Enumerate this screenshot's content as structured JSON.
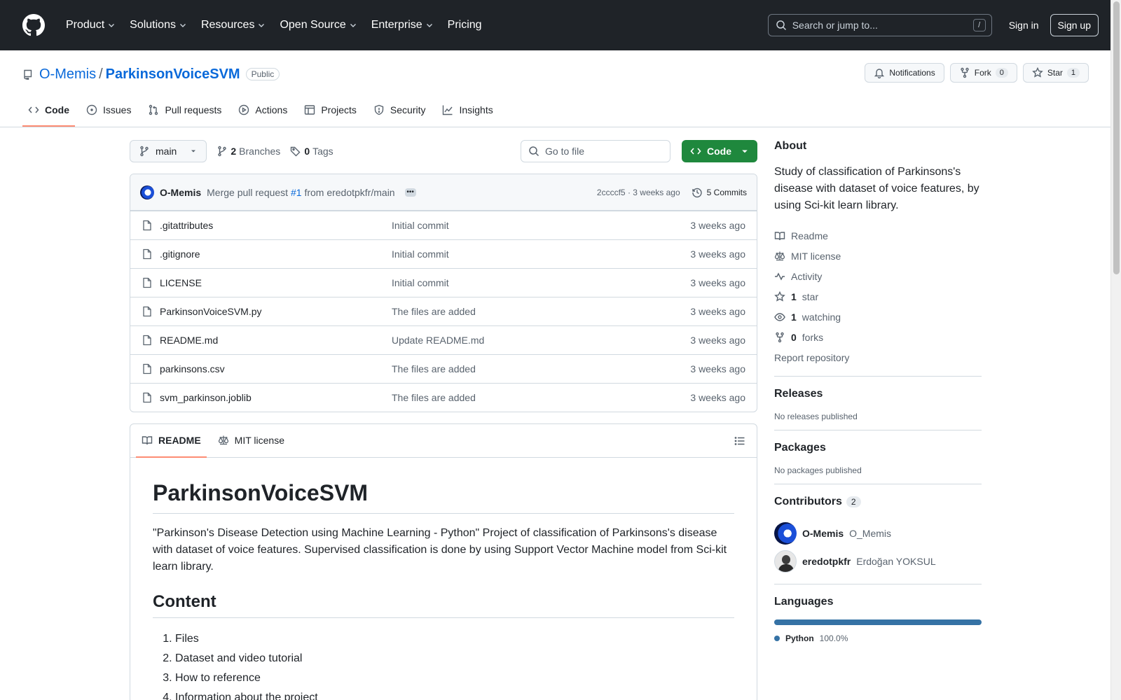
{
  "nav": {
    "items": [
      "Product",
      "Solutions",
      "Resources",
      "Open Source",
      "Enterprise",
      "Pricing"
    ],
    "search_placeholder": "Search or jump to...",
    "search_kbd": "/",
    "signin": "Sign in",
    "signup": "Sign up"
  },
  "repo": {
    "owner": "O-Memis",
    "slash": "/",
    "name": "ParkinsonVoiceSVM",
    "visibility": "Public",
    "notifications": "Notifications",
    "fork": "Fork",
    "fork_count": "0",
    "star": "Star",
    "star_count": "1",
    "tabs": [
      "Code",
      "Issues",
      "Pull requests",
      "Actions",
      "Projects",
      "Security",
      "Insights"
    ]
  },
  "toolbar": {
    "branch": "main",
    "branches_count": "2",
    "branches_label": "Branches",
    "tags_count": "0",
    "tags_label": "Tags",
    "goto_placeholder": "Go to file",
    "code_button": "Code"
  },
  "commit": {
    "author": "O-Memis",
    "msg_prefix": "Merge pull request",
    "pr": "#1",
    "msg_suffix": "from eredotpkfr/main",
    "ellipsis": "•••",
    "hash_time": "2ccccf5 · 3 weeks ago",
    "commits": "5 Commits"
  },
  "files": [
    {
      "name": ".gitattributes",
      "msg": "Initial commit",
      "date": "3 weeks ago"
    },
    {
      "name": ".gitignore",
      "msg": "Initial commit",
      "date": "3 weeks ago"
    },
    {
      "name": "LICENSE",
      "msg": "Initial commit",
      "date": "3 weeks ago"
    },
    {
      "name": "ParkinsonVoiceSVM.py",
      "msg": "The files are added",
      "date": "3 weeks ago"
    },
    {
      "name": "README.md",
      "msg": "Update README.md",
      "date": "3 weeks ago"
    },
    {
      "name": "parkinsons.csv",
      "msg": "The files are added",
      "date": "3 weeks ago"
    },
    {
      "name": "svm_parkinson.joblib",
      "msg": "The files are added",
      "date": "3 weeks ago"
    }
  ],
  "readme": {
    "tab_readme": "README",
    "tab_license": "MIT license",
    "title": "ParkinsonVoiceSVM",
    "intro": "\"Parkinson's Disease Detection using Machine Learning - Python\" Project of classification of Parkinsons's disease with dataset of voice features. Supervised classification is done by using Support Vector Machine model from Sci-kit learn library.",
    "content_heading": "Content",
    "content_items": [
      "Files",
      "Dataset and video tutorial",
      "How to reference",
      "Information about the project"
    ]
  },
  "about": {
    "heading": "About",
    "description": "Study of classification of Parkinsons's disease with dataset of voice features, by using Sci-kit learn library.",
    "readme": "Readme",
    "license": "MIT license",
    "activity": "Activity",
    "stars_count": "1",
    "stars_label": "star",
    "watching_count": "1",
    "watching_label": "watching",
    "forks_count": "0",
    "forks_label": "forks",
    "report": "Report repository"
  },
  "releases": {
    "heading": "Releases",
    "empty": "No releases published"
  },
  "packages": {
    "heading": "Packages",
    "empty": "No packages published"
  },
  "contributors": {
    "heading": "Contributors",
    "count": "2",
    "people": [
      {
        "login": "O-Memis",
        "name": "O_Memis"
      },
      {
        "login": "eredotpkfr",
        "name": "Erdoğan YOKSUL"
      }
    ]
  },
  "languages": {
    "heading": "Languages",
    "items": [
      {
        "name": "Python",
        "pct": "100.0%",
        "fraction": 1.0,
        "color": "#3572A5"
      }
    ]
  },
  "colors": {
    "accent": "#0969da",
    "primary_button": "#1f883d",
    "tab_underline": "#fd8c73",
    "header_bg": "#1f2328"
  }
}
